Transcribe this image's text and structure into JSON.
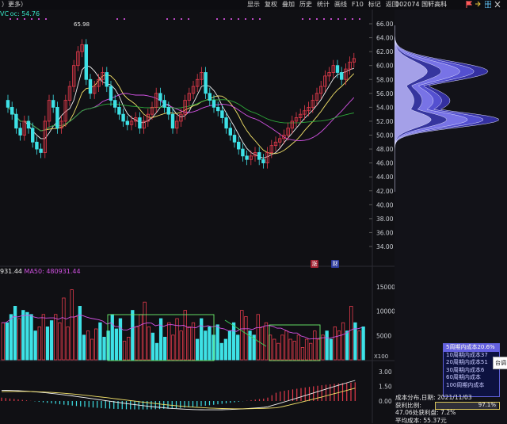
{
  "toolbar": {
    "left_label": "更多",
    "menu": [
      "显示",
      "复权",
      "叠加",
      "历史",
      "统计",
      "画线",
      "F10",
      "标记",
      "返回"
    ],
    "stock_code": "002074",
    "stock_name": "国轩高科"
  },
  "main_chart": {
    "legend": "VC oc: 54.76",
    "high_marker": "65.98",
    "y_ticks": [
      "66.00",
      "64.00",
      "62.00",
      "60.00",
      "58.00",
      "56.00",
      "54.00",
      "52.00",
      "50.00",
      "48.00",
      "46.00",
      "44.00",
      "42.00",
      "40.00",
      "38.00",
      "36.00",
      "34.00"
    ],
    "tags": [
      {
        "label": "涨",
        "color": "#cc3344"
      },
      {
        "label": "财",
        "color": "#3344cc"
      }
    ]
  },
  "volume_chart": {
    "legend_left": "931.44",
    "legend_ma50": "MA50: 480931.44",
    "y_ticks": [
      "15000",
      "10000",
      "5000"
    ],
    "unit": "X100",
    "values": [
      18,
      18,
      22,
      26,
      20,
      24,
      23,
      22,
      14,
      16,
      22,
      16,
      19,
      22,
      18,
      30,
      16,
      34,
      21,
      26,
      12,
      14,
      10,
      15,
      18,
      11,
      14,
      22,
      15,
      20,
      9,
      11,
      24,
      16,
      22,
      28,
      16,
      13,
      8,
      20,
      11,
      18,
      12,
      20,
      14,
      24,
      16,
      18,
      10,
      20,
      14,
      16,
      12,
      17,
      8,
      10,
      14,
      18,
      12,
      24,
      21,
      14,
      12,
      22,
      16,
      18,
      12,
      10,
      8,
      12,
      14,
      10,
      9,
      12,
      6,
      10,
      8,
      14,
      10,
      12,
      14,
      10,
      16,
      14,
      18,
      14,
      26,
      18,
      14,
      16
    ],
    "colors_up": "#e53b4b",
    "colors_down": "#3ee1e6"
  },
  "macd_chart": {
    "y_ticks": [
      "3.00",
      "1.50",
      "0.00"
    ]
  },
  "cost_distribution": {
    "legend_items": [
      "5周期内成本20.6%",
      "10周期内成本37",
      "20周期内成本51",
      "30周期内成本6",
      "60周期内成本",
      "100周期内成本"
    ],
    "side_note": "台调",
    "title": "成本分布,日期: 2021/11/03",
    "profit_label": "获利比例:",
    "profit_value": "97.1%",
    "profit_ratio": 0.971,
    "profit_line": "47.06处获利盘: 7.2%",
    "avg_cost": "平均成本: 55.37元"
  },
  "colors": {
    "up": "#e53b4b",
    "down": "#3ee1e6",
    "ma5": "#f0f0f0",
    "ma10": "#f5e46a",
    "ma20": "#d252e3",
    "ma60": "#2ea83a",
    "accent_box": "#6cf06c",
    "cost_fill": "#5a56d8"
  }
}
